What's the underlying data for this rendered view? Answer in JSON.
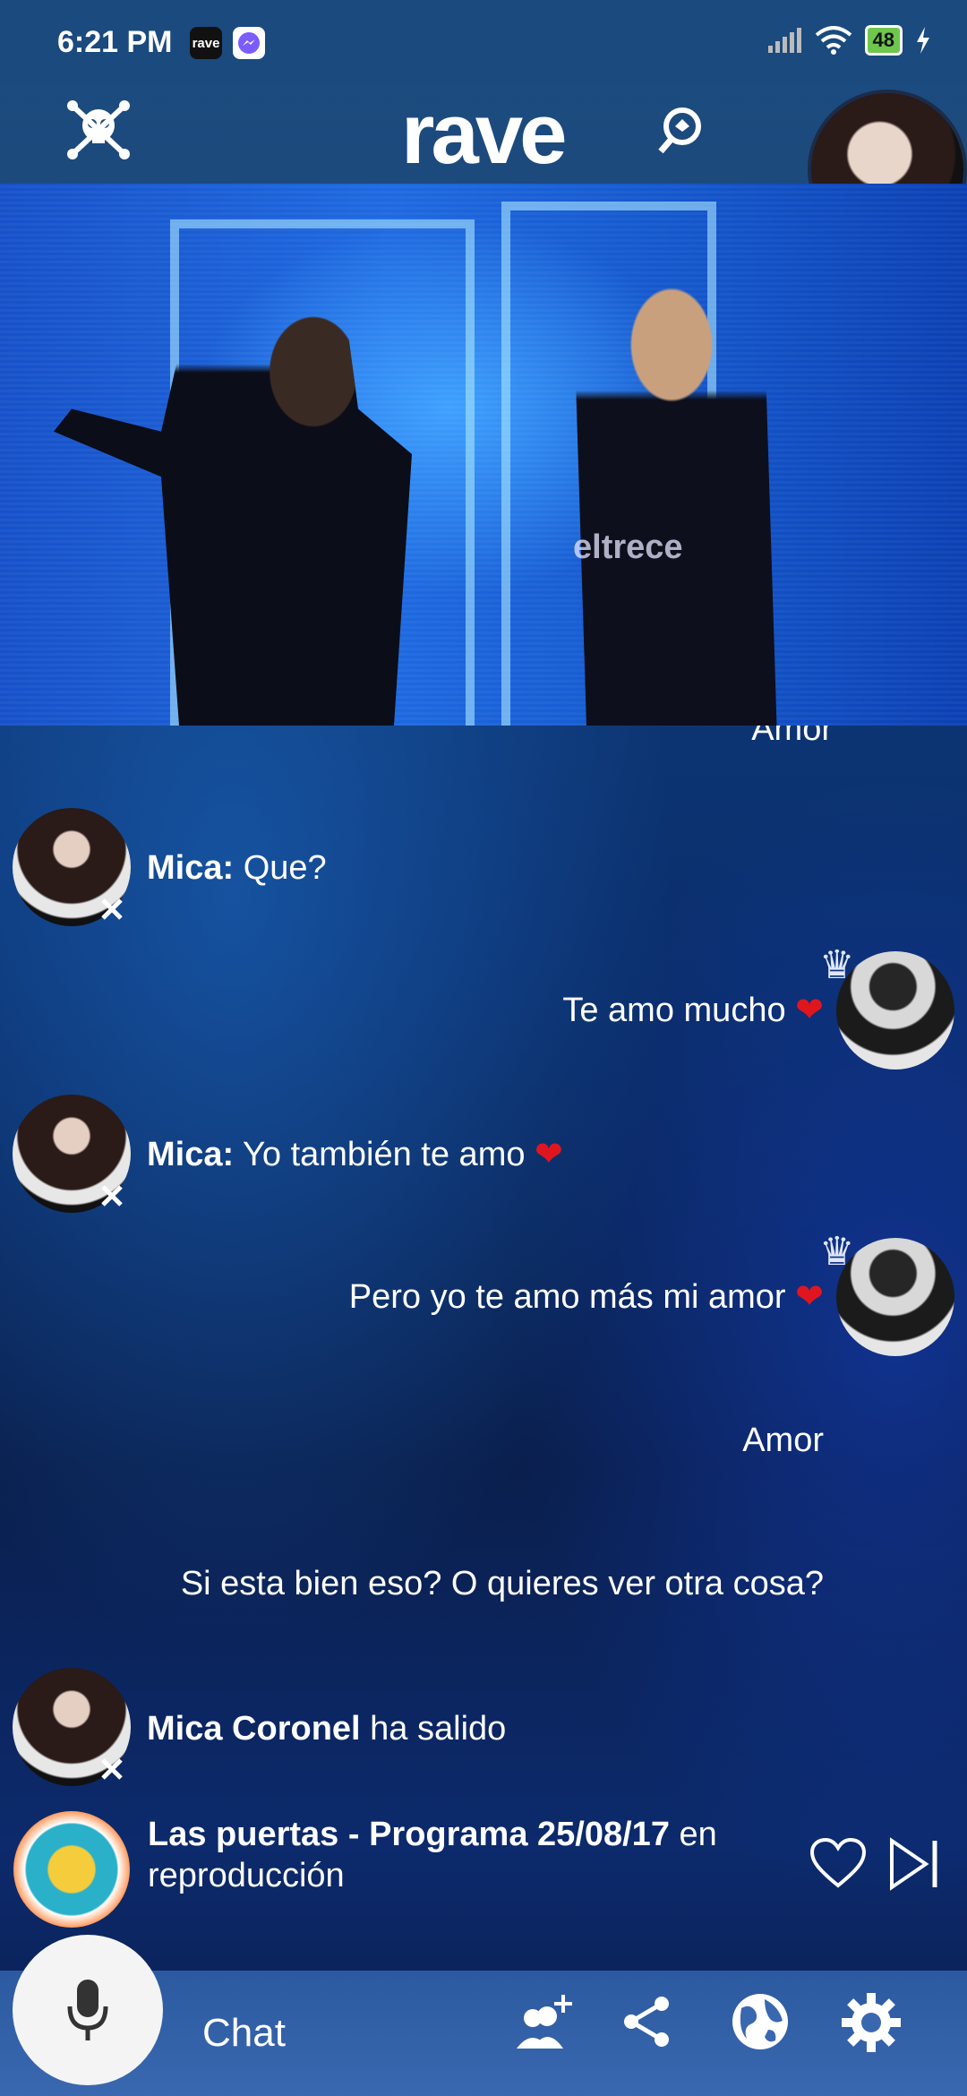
{
  "status": {
    "time": "6:21 PM",
    "app_icon_1": "rave",
    "battery": "48"
  },
  "header": {
    "logo": "rave"
  },
  "video": {
    "watermark": "eltrece"
  },
  "chat": {
    "partial_top": "Amor",
    "messages": [
      {
        "sender": "Mica:",
        "text": "Que?"
      },
      {
        "text": "Te amo mucho"
      },
      {
        "sender": "Mica:",
        "text": "Yo también te amo"
      },
      {
        "text": "Pero yo te amo más mi amor"
      },
      {
        "text": "Amor"
      },
      {
        "text": "Si esta bien eso? O quieres ver otra cosa?"
      },
      {
        "sender": "Mica Coronel",
        "text": "ha salido"
      }
    ]
  },
  "now_playing": {
    "title": "Las puertas - Programa 25/08/17",
    "suffix": "en reproducción"
  },
  "bottom_bar": {
    "chat_label": "Chat"
  },
  "colors": {
    "heart": "#e0161f",
    "top_bar": "#1b4b7f",
    "bottom_bar": "#3a68b0"
  }
}
